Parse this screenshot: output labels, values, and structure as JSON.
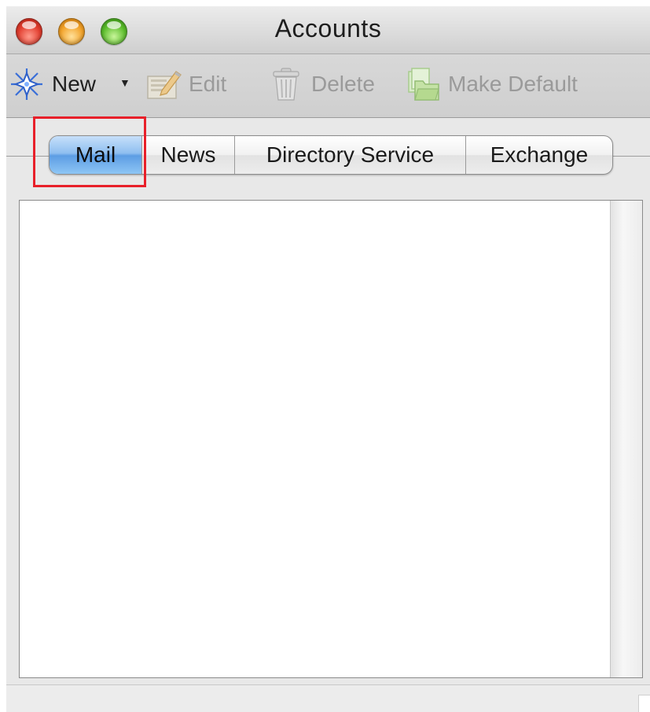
{
  "window": {
    "title": "Accounts"
  },
  "toolbar": {
    "new_label": "New",
    "dropdown_glyph": "▼",
    "edit_label": "Edit",
    "delete_label": "Delete",
    "make_default_label": "Make Default",
    "icons": {
      "new": "sparkle-icon",
      "edit": "pencil-edit-icon",
      "delete": "trash-icon",
      "make_default": "folder-default-icon"
    }
  },
  "tabs": [
    {
      "label": "Mail",
      "active": true
    },
    {
      "label": "News",
      "active": false
    },
    {
      "label": "Directory Service",
      "active": false
    },
    {
      "label": "Exchange",
      "active": false
    }
  ],
  "colors": {
    "active_tab": "#5d9de4",
    "highlight": "#e8202a",
    "disabled_text": "#9a9a9a"
  }
}
